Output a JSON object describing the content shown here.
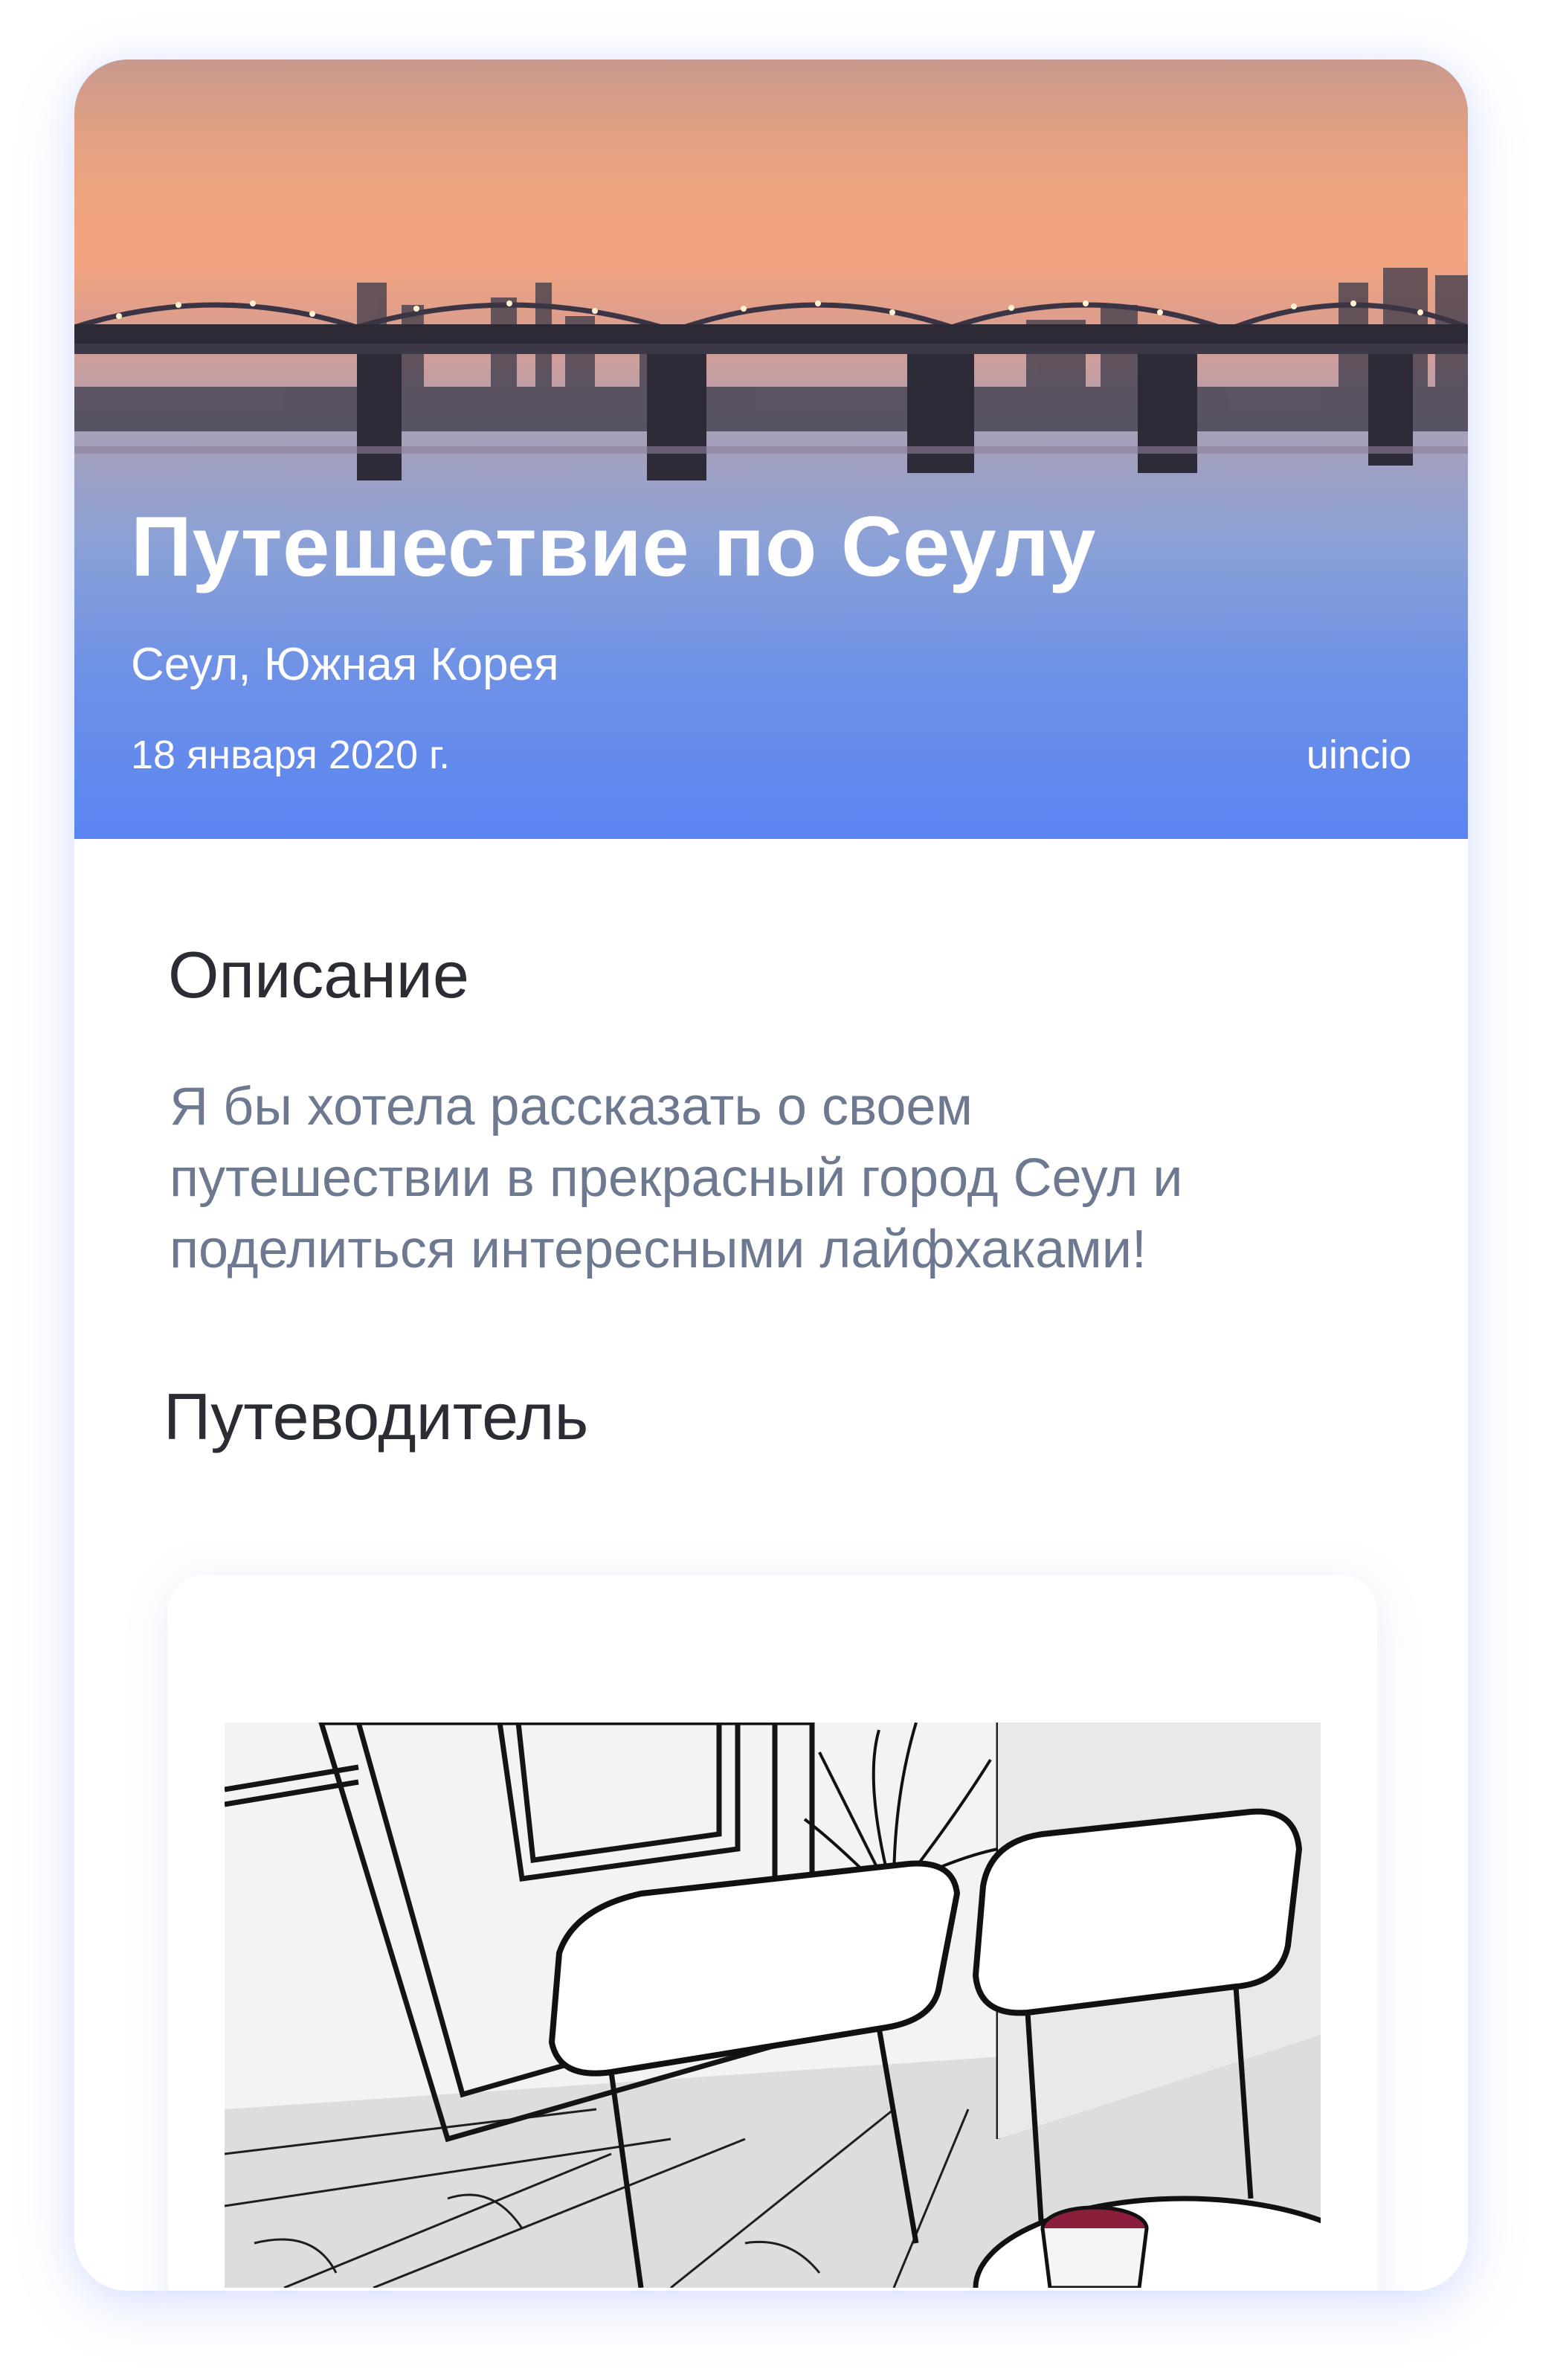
{
  "hero": {
    "title": "Путешествие по Сеулу",
    "location": "Сеул, Южная Корея",
    "date": "18 января 2020 г.",
    "author": "uincio"
  },
  "description": {
    "heading": "Описание",
    "lines": [
      "Я бы хотела рассказать о своем",
      "путешествии в прекрасный город Сеул и",
      "поделиться интересными лайфхаками!"
    ]
  },
  "guide": {
    "heading": "Путеводитель"
  },
  "colors": {
    "accent": "#5a84f2",
    "heading": "#2a2d34",
    "body_text": "#6d7891"
  }
}
